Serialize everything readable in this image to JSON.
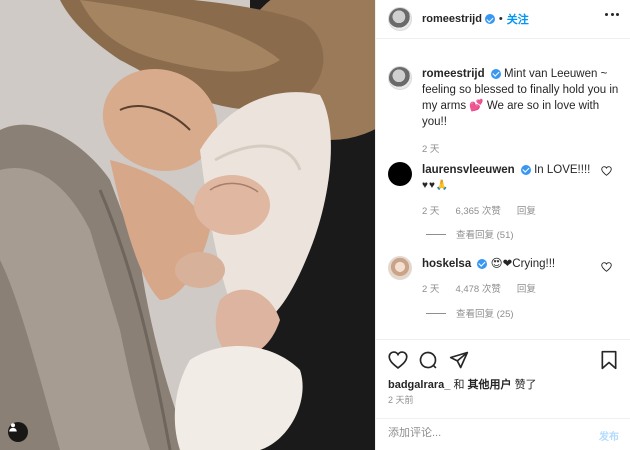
{
  "post": {
    "author": "romeestrijd",
    "separator": "•",
    "follow_label": "关注"
  },
  "caption": {
    "author": "romeestrijd",
    "text": "Mint van Leeuwen ~ feeling so blessed to finally hold you in my arms",
    "emoji": "💕",
    "text2": "We are so in love with you!!",
    "time": "2 天"
  },
  "comments": [
    {
      "author": "laurensvleeuwen",
      "text": "In LOVE!!!!",
      "emoji_line": "♥♥🙏",
      "time": "2 天",
      "likes": "6,365 次赞",
      "reply_label": "回复",
      "view_replies": "查看回复 (51)"
    },
    {
      "author": "hoskelsa",
      "emoji": "😍❤",
      "text": "Crying!!!",
      "time": "2 天",
      "likes": "4,478 次赞",
      "reply_label": "回复",
      "view_replies": "查看回复 (25)"
    }
  ],
  "likes": {
    "liked_by": "badgalrara_",
    "rest": "和",
    "others": "其他用户",
    "suffix": "赞了"
  },
  "time_ago": "2 天前",
  "add_comment": {
    "placeholder": "添加评论...",
    "post_label": "发布"
  },
  "icons": [
    "user-tag-icon",
    "verified-icon",
    "more-options-icon",
    "like-icon",
    "comment-icon",
    "share-icon",
    "save-icon"
  ],
  "colors": {
    "accent": "#0095f6",
    "verified": "#3897f0",
    "muted": "#8e8e8e",
    "text": "#262626"
  }
}
